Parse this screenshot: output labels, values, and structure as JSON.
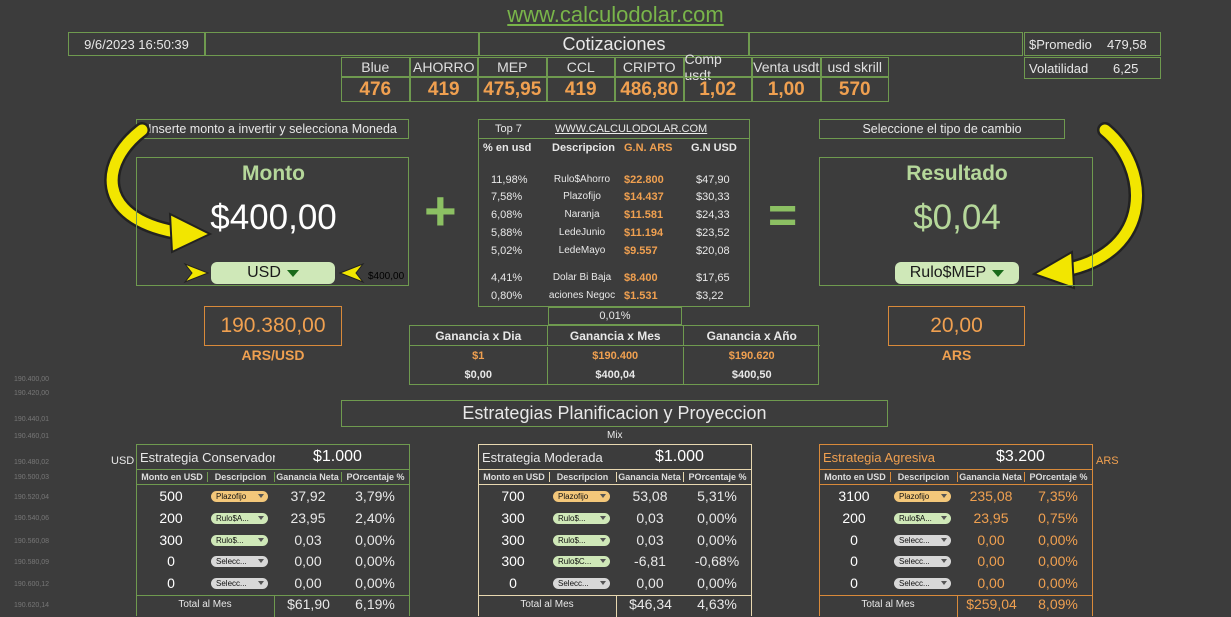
{
  "site": "www.calculodolar.com",
  "datetime": "9/6/2023 16:50:39",
  "cotizaciones_title": "Cotizaciones",
  "promedio": {
    "label": "$Promedio",
    "value": "479,58"
  },
  "volatilidad": {
    "label": "Volatilidad",
    "value": "6,25"
  },
  "rates": [
    {
      "name": "Blue",
      "value": "476"
    },
    {
      "name": "AHORRO",
      "value": "419"
    },
    {
      "name": "MEP",
      "value": "475,95"
    },
    {
      "name": "CCL",
      "value": "419"
    },
    {
      "name": "CRIPTO",
      "value": "486,80"
    },
    {
      "name": "Comp usdt",
      "value": "1,02"
    },
    {
      "name": "Venta usdt",
      "value": "1,00"
    },
    {
      "name": "usd skrill",
      "value": "570"
    }
  ],
  "left": {
    "hint": "Inserte monto a invertir y selecciona Moneda",
    "title": "Monto",
    "amount": "$400,00",
    "currency": "USD",
    "side_value": "$400,00",
    "ars_value": "190.380,00",
    "ars_label": "ARS/USD"
  },
  "right": {
    "hint": "Seleccione el tipo de cambio",
    "title": "Resultado",
    "amount": "$0,04",
    "rate_type": "Rulo$MEP",
    "ars_value": "20,00",
    "ars_label": "ARS"
  },
  "plus": "+",
  "equals": "=",
  "top7": {
    "label": "Top 7",
    "link": "WWW.CALCULODOLAR.COM",
    "headers": [
      "% en usd",
      "Descripcion",
      "G.N. ARS",
      "G.N USD"
    ],
    "rows": [
      {
        "pct": "11,98%",
        "desc": "Rulo$Ahorro",
        "ars": "$22.800",
        "usd": "$47,90"
      },
      {
        "pct": "7,58%",
        "desc": "Plazofijo",
        "ars": "$14.437",
        "usd": "$30,33"
      },
      {
        "pct": "6,08%",
        "desc": "Naranja",
        "ars": "$11.581",
        "usd": "$24,33"
      },
      {
        "pct": "5,88%",
        "desc": "LedeJunio",
        "ars": "$11.194",
        "usd": "$23,52"
      },
      {
        "pct": "5,02%",
        "desc": "LedeMayo",
        "ars": "$9.557",
        "usd": "$20,08"
      },
      {
        "pct": "4,41%",
        "desc": "Dolar Bi Baja",
        "ars": "$8.400",
        "usd": "$17,65"
      },
      {
        "pct": "0,80%",
        "desc": "aciones Negoc",
        "ars": "$1.531",
        "usd": "$3,22"
      }
    ],
    "footer": "0,01%"
  },
  "ganancias": {
    "headers": [
      "Ganancia x Dia",
      "Ganancia x Mes",
      "Ganancia x Año"
    ],
    "ars": [
      "$1",
      "$190.400",
      "$190.620"
    ],
    "usd": [
      "$0,00",
      "$400,04",
      "$400,50"
    ]
  },
  "estrategias_title": "Estrategias Planificacion y Proyeccion",
  "mix_label": "Mix",
  "usd_label": "USD",
  "ars_label": "ARS",
  "ghost_values": [
    "190.400,00",
    "190.420,00",
    "190.440,01",
    "190.460,01",
    "190.480,02",
    "190.500,03",
    "190.520,04",
    "190.540,06",
    "190.560,08",
    "190.580,09",
    "190.600,12",
    "190.620,14"
  ],
  "strategies": [
    {
      "name": "Estrategia Conservador",
      "total": "$1.000",
      "headers": [
        "Monto en USD",
        "Descripcion",
        "Ganancia Neta",
        "POrcentaje %"
      ],
      "rows": [
        {
          "monto": "500",
          "desc": "Plazofijo",
          "neta": "37,92",
          "pct": "3,79%",
          "color": "#f3c77a"
        },
        {
          "monto": "200",
          "desc": "Rulo$A...",
          "neta": "23,95",
          "pct": "2,40%",
          "color": "#cfe8b8"
        },
        {
          "monto": "300",
          "desc": "Rulo$...",
          "neta": "0,03",
          "pct": "0,00%",
          "color": "#cfe8b8"
        },
        {
          "monto": "0",
          "desc": "Selecc...",
          "neta": "0,00",
          "pct": "0,00%",
          "color": "#d8d8d8"
        },
        {
          "monto": "0",
          "desc": "Selecc...",
          "neta": "0,00",
          "pct": "0,00%",
          "color": "#d8d8d8"
        }
      ],
      "footer_label": "Total al Mes",
      "footer_neta": "$61,90",
      "footer_pct": "6,19%"
    },
    {
      "name": "Estrategia Moderada",
      "total": "$1.000",
      "headers": [
        "Monto en USD",
        "Descripcion",
        "Ganancia Neta",
        "POrcentaje %"
      ],
      "rows": [
        {
          "monto": "700",
          "desc": "Plazofijo",
          "neta": "53,08",
          "pct": "5,31%",
          "color": "#f3c77a"
        },
        {
          "monto": "300",
          "desc": "Rulo$...",
          "neta": "0,03",
          "pct": "0,00%",
          "color": "#cfe8b8"
        },
        {
          "monto": "300",
          "desc": "Rulo$...",
          "neta": "0,03",
          "pct": "0,00%",
          "color": "#cfe8b8"
        },
        {
          "monto": "300",
          "desc": "Rulo$C...",
          "neta": "-6,81",
          "pct": "-0,68%",
          "color": "#cfe8b8"
        },
        {
          "monto": "0",
          "desc": "Selecc...",
          "neta": "0,00",
          "pct": "0,00%",
          "color": "#d8d8d8"
        }
      ],
      "footer_label": "Total al Mes",
      "footer_neta": "$46,34",
      "footer_pct": "4,63%"
    },
    {
      "name": "Estrategia Agresiva",
      "total": "$3.200",
      "headers": [
        "Monto en USD",
        "Descripcion",
        "Ganancia Neta",
        "POrcentaje %"
      ],
      "rows": [
        {
          "monto": "3100",
          "desc": "Plazofijo",
          "neta": "235,08",
          "pct": "7,35%",
          "color": "#f3c77a"
        },
        {
          "monto": "200",
          "desc": "Rulo$A...",
          "neta": "23,95",
          "pct": "0,75%",
          "color": "#cfe8b8"
        },
        {
          "monto": "0",
          "desc": "Selecc...",
          "neta": "0,00",
          "pct": "0,00%",
          "color": "#d8d8d8"
        },
        {
          "monto": "0",
          "desc": "Selecc...",
          "neta": "0,00",
          "pct": "0,00%",
          "color": "#d8d8d8"
        },
        {
          "monto": "0",
          "desc": "Selecc...",
          "neta": "0,00",
          "pct": "0,00%",
          "color": "#d8d8d8"
        }
      ],
      "footer_label": "Total al Mes",
      "footer_neta": "$259,04",
      "footer_pct": "8,09%"
    }
  ]
}
